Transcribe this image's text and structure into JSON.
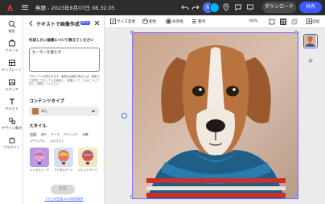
{
  "topbar": {
    "doc_title": "無題 - 2023年8月07日 08.32.05",
    "avatar_initial": "N",
    "download_label": "ダウンロード",
    "share_label": "共有"
  },
  "rail": {
    "items": [
      {
        "label": "検索",
        "icon": "search-icon"
      },
      {
        "label": "ブランド",
        "icon": "brand-icon"
      },
      {
        "label": "テンプレート",
        "icon": "template-icon"
      },
      {
        "label": "メディア",
        "icon": "media-icon"
      },
      {
        "label": "テキスト",
        "icon": "text-icon"
      },
      {
        "label": "デザイン素材",
        "icon": "design-assets-icon"
      },
      {
        "label": "プラグイン",
        "icon": "plugin-icon"
      }
    ]
  },
  "panel": {
    "title": "テキストで画像作成",
    "beta": "BETA",
    "prompt_label": "作成したい画像について教えてください",
    "prompt_value": "セーターを着た犬",
    "hint": "プロンプトが短すぎます。最適な結果を得るには、単語より文章にプロンプトを使用し、詳細として、ものについて詳しく説明してください。",
    "content_type_label": "コンテンツタイプ",
    "content_type_value": "なし",
    "style_label": "スタイル",
    "chips": [
      "人気",
      "流行",
      "テーマ",
      "テクニック",
      "効果",
      "マテリアル",
      "コンセプト"
    ],
    "selected_chip": "人気",
    "styles": [
      {
        "label": "シンセウェーブ"
      },
      {
        "label": "デジタルアート"
      },
      {
        "label": "パレットナイフ"
      }
    ],
    "generate_label": "生成",
    "terms_link": "アドビの生成 AI の利用条件"
  },
  "toolbar": {
    "resize_label": "サイズ変更",
    "color_label": "配色",
    "bg_label": "背景色",
    "arrange_label": "整列",
    "zoom": "60%",
    "add_label": "追加"
  },
  "colors": {
    "accent": "#3b5bfd",
    "topbar_bg": "#2c2c2c",
    "selection": "#7a6cff"
  }
}
